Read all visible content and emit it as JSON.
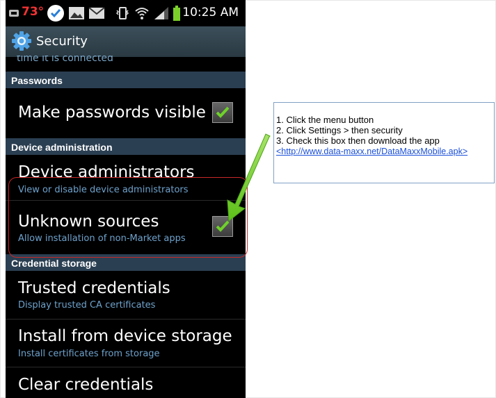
{
  "status_bar": {
    "temperature": "73°",
    "time": "10:25 AM"
  },
  "header": {
    "title": "Security",
    "clipped_text": "time it is connected"
  },
  "sections": {
    "passwords": "Passwords",
    "device_admin": "Device administration",
    "credential_storage": "Credential storage"
  },
  "items": {
    "make_passwords_visible": {
      "title": "Make passwords visible",
      "checked": true
    },
    "device_administrators": {
      "title": "Device administrators",
      "subtitle": "View or disable device administrators"
    },
    "unknown_sources": {
      "title": "Unknown sources",
      "subtitle": "Allow installation of non-Market apps",
      "checked": true
    },
    "trusted_credentials": {
      "title": "Trusted credentials",
      "subtitle": "Display trusted CA certificates"
    },
    "install_from_storage": {
      "title": "Install from device storage",
      "subtitle": "Install certificates from storage"
    },
    "clear_credentials": {
      "title": "Clear credentials"
    }
  },
  "callout": {
    "line1": "1. Click the menu button",
    "line2": "2. Click Settings > then security",
    "line3": "3. Check this box then download the app",
    "link": "<http://www.data-maxx.net/DataMaxxMobile.apk>"
  },
  "colors": {
    "accent_green": "#6fd12a",
    "highlight_red": "#c82828",
    "section_bg": "#2b3f52",
    "subtitle_blue": "#6ea2cc"
  }
}
